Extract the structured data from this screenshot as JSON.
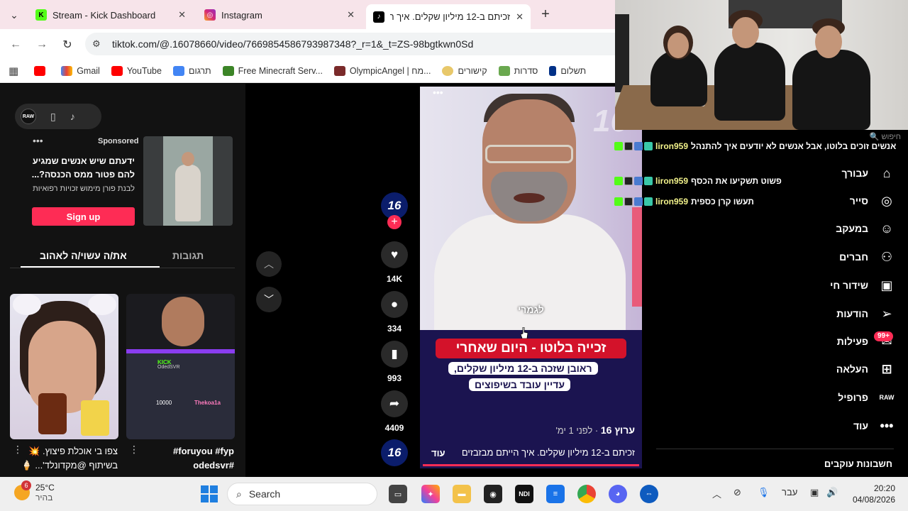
{
  "browser": {
    "tabs": [
      {
        "title": "Stream - Kick Dashboard",
        "favicon": "kick-favicon"
      },
      {
        "title": "Instagram",
        "favicon": "instagram-favicon"
      },
      {
        "title": "זכיתם ב-12 מיליון שקלים. איך ה",
        "favicon": "tiktok-favicon"
      }
    ],
    "url": "tiktok.com/@.16078660/video/7669854586793987348?_r=1&_t=ZS-98bgtkwn0Sd",
    "bookmarks": [
      {
        "label": "",
        "icon": "apps-grid-icon"
      },
      {
        "label": "",
        "icon": "youtube-icon"
      },
      {
        "label": "Gmail",
        "icon": "gmail-icon"
      },
      {
        "label": "YouTube",
        "icon": "youtube-icon"
      },
      {
        "label": "תרגום",
        "icon": "translate-icon"
      },
      {
        "label": "Free Minecraft Serv...",
        "icon": "minecraft-icon"
      },
      {
        "label": "OlympicAngel | מח...",
        "icon": "olympic-icon"
      },
      {
        "label": "קישורים",
        "icon": "links-icon"
      },
      {
        "label": "סדרות",
        "icon": "series-icon"
      },
      {
        "label": "תשלום",
        "icon": "paypal-icon"
      }
    ]
  },
  "ad": {
    "sponsored": "Sponsored",
    "text": "ידעתם שיש אנשים שמגיע להם פטור ממס הכנסה?...",
    "sub": "לבנת פורן מימוש זכויות רפואיות",
    "cta": "Sign up"
  },
  "left_tabs": {
    "active": "את/ה עשוי/ה לאהוב",
    "other": "תגובות"
  },
  "thumbnails": [
    {
      "caption_line1": "צפו בי אוכלת פיצוץ. 💥",
      "caption_line2": "בשיתוף @מקדונלד'... 🍦",
      "kick_label": "",
      "kick_name": ""
    },
    {
      "caption_line1": "foruyou #fyp#",
      "caption_line2": "#odedsvr",
      "kick_label": "KICK",
      "kick_name": "OdedSVR",
      "overlay_num": "10000",
      "overlay_name": "Thekoa1a"
    }
  ],
  "actions": {
    "likes": "14K",
    "comments": "334",
    "saves": "993",
    "shares": "4409",
    "avatar_text": "16"
  },
  "video": {
    "watermark": "16",
    "subtitle": "לגמרי",
    "headline": "זכייה בלוטו - היום שאחרי",
    "line1": "ראובן שזכה ב-12 מיליון שקלים,",
    "line2": "עדיין עובד בשיפוצים",
    "channel": "ערוץ 16",
    "time": "לפני 1 ימ'",
    "description": "זכיתם ב-12 מיליון שקלים. איך הייתם מבזבזים",
    "more": "עוד"
  },
  "sidenav": {
    "search_placeholder": "חיפוש",
    "items": [
      {
        "label": "עבורך",
        "icon": "home-icon"
      },
      {
        "label": "סייר",
        "icon": "compass-icon"
      },
      {
        "label": "במעקב",
        "icon": "user-follow-icon"
      },
      {
        "label": "חברים",
        "icon": "friends-icon"
      },
      {
        "label": "שידור חי",
        "icon": "live-icon"
      },
      {
        "label": "הודעות",
        "icon": "send-icon"
      },
      {
        "label": "פעילות",
        "icon": "inbox-icon"
      },
      {
        "label": "העלאה",
        "icon": "upload-icon"
      },
      {
        "label": "פרופיל",
        "icon": "profile-icon"
      },
      {
        "label": "עוד",
        "icon": "more-icon"
      }
    ],
    "activity_badge": "99+",
    "following_accounts": "חשבונות עוקבים"
  },
  "chat": [
    {
      "user": "liron959",
      "msg": "אנשים זוכים בלוטו, אבל אנשים לא יודעים איך להתנהל"
    },
    {
      "user": "liron959",
      "msg": "פשוט תשקיעו את הכסף"
    },
    {
      "user": "liron959",
      "msg": "תעשו קרן כספית"
    }
  ],
  "taskbar": {
    "temp": "25°C",
    "weather": "בהיר",
    "weather_badge": "6",
    "search": "Search",
    "lang": "עבר",
    "time": "20:20",
    "date": "04/08/2026"
  }
}
